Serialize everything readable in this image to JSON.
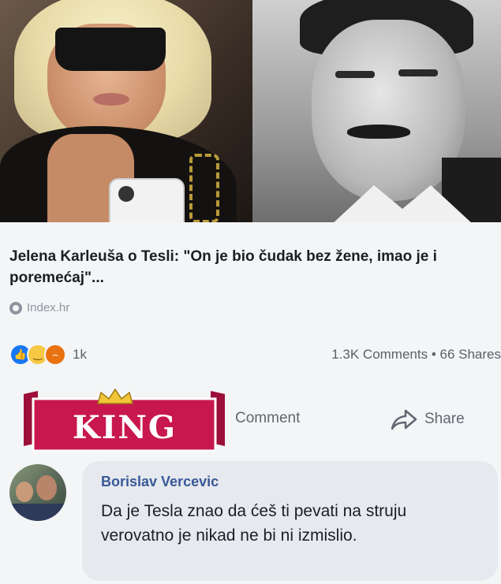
{
  "post": {
    "headline": "Jelena Karleuša o Tesli: \"On je bio čudak bez žene, imao je i poremećaj\"...",
    "source": "Index.hr",
    "reactions": {
      "icons": [
        "like-icon",
        "haha-icon",
        "angry-icon"
      ],
      "count": "1k"
    },
    "stats": "1.3K Comments • 66 Shares"
  },
  "actions": {
    "comment_label": "Comment",
    "share_label": "Share"
  },
  "watermark": {
    "text": "KING",
    "colors": {
      "banner": "#c8174f",
      "crown": "#f0c53a",
      "text": "#ffffff"
    }
  },
  "comment": {
    "author": "Borislav Vercevic",
    "text": "Da je Tesla znao da ćeš ti pevati na struju verovatno je nikad ne bi ni izmislio."
  },
  "colors": {
    "background": "#f4f5f7",
    "link_name": "#385898",
    "like_blue": "#1877f2"
  }
}
